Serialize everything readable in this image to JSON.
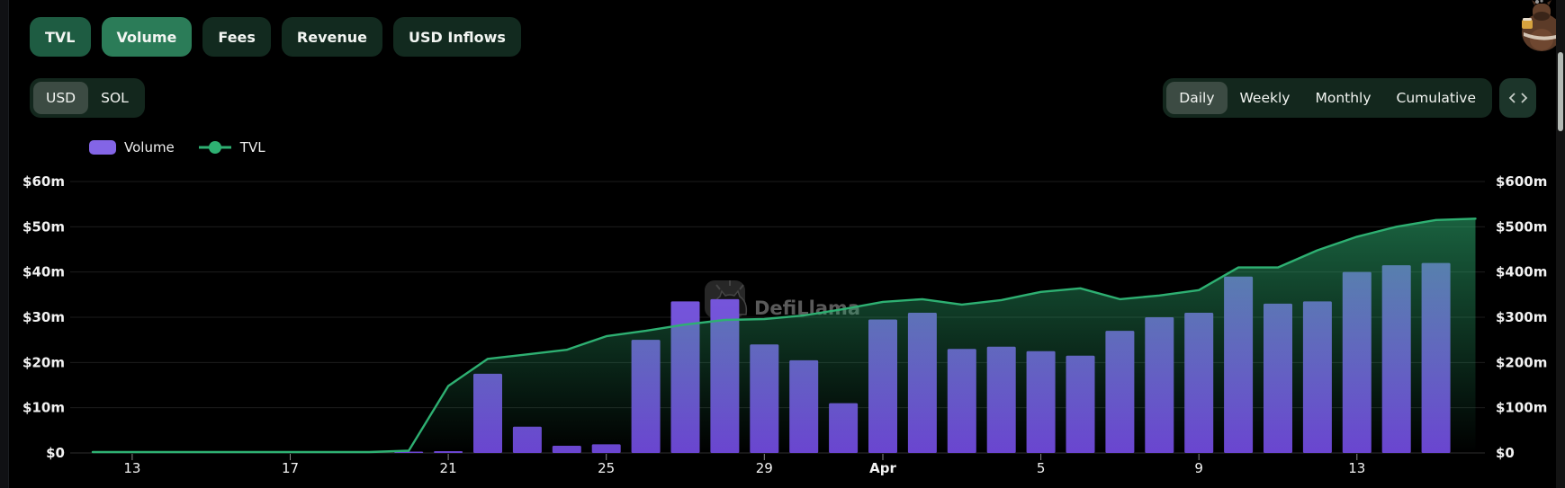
{
  "toolbar": {
    "metric_buttons": [
      {
        "label": "TVL",
        "active": true
      },
      {
        "label": "Volume",
        "active": true
      },
      {
        "label": "Fees",
        "active": false
      },
      {
        "label": "Revenue",
        "active": false
      },
      {
        "label": "USD Inflows",
        "active": false
      }
    ]
  },
  "currency_toggle": {
    "options": [
      "USD",
      "SOL"
    ],
    "selected": "USD"
  },
  "interval_toggle": {
    "options": [
      "Daily",
      "Weekly",
      "Monthly",
      "Cumulative"
    ],
    "selected": "Daily"
  },
  "embed_button": {
    "icon": "code-brackets"
  },
  "legend": [
    {
      "label": "Volume",
      "type": "bar",
      "color": "#8365e6"
    },
    {
      "label": "TVL",
      "type": "line",
      "color": "#2eb072"
    }
  ],
  "watermark": {
    "text": "DefiLlama"
  },
  "chart_data": {
    "type": "bar+line",
    "title": "Volume and TVL (Daily, USD)",
    "dates": [
      "Mar 12",
      "Mar 13",
      "Mar 14",
      "Mar 15",
      "Mar 16",
      "Mar 17",
      "Mar 18",
      "Mar 19",
      "Mar 20",
      "Mar 21",
      "Mar 22",
      "Mar 23",
      "Mar 24",
      "Mar 25",
      "Mar 26",
      "Mar 27",
      "Mar 28",
      "Mar 29",
      "Mar 30",
      "Mar 31",
      "Apr 1",
      "Apr 2",
      "Apr 3",
      "Apr 4",
      "Apr 5",
      "Apr 6",
      "Apr 7",
      "Apr 8",
      "Apr 9",
      "Apr 10",
      "Apr 11",
      "Apr 12",
      "Apr 13",
      "Apr 14",
      "Apr 15",
      "Apr 16"
    ],
    "series": [
      {
        "name": "Volume",
        "type": "bar",
        "axis": "left",
        "unit": "$m",
        "color_top": "#7e62e2",
        "color_bottom": "#6a45d0",
        "values": [
          0,
          0,
          0,
          0,
          0,
          0,
          0,
          0,
          0.3,
          0.4,
          17.5,
          5.8,
          1.6,
          1.9,
          25,
          33.5,
          34,
          24,
          20.5,
          11,
          29.5,
          31,
          23,
          23.5,
          22.5,
          21.5,
          27,
          30,
          31,
          39,
          33,
          33.5,
          40,
          41.5,
          42,
          null
        ]
      },
      {
        "name": "TVL",
        "type": "line",
        "axis": "right",
        "unit": "$m",
        "color": "#2eb072",
        "area_top": "rgba(46,176,114,0.55)",
        "area_bottom": "rgba(46,176,114,0)",
        "values": [
          2,
          2,
          2,
          2,
          2,
          2,
          2,
          2,
          5,
          148,
          208,
          218,
          228,
          258,
          270,
          284,
          294,
          296,
          304,
          318,
          334,
          340,
          328,
          338,
          356,
          364,
          340,
          348,
          360,
          410,
          410,
          448,
          478,
          500,
          515,
          518
        ]
      }
    ],
    "left_axis": {
      "ticks": [
        "$0",
        "$10m",
        "$20m",
        "$30m",
        "$40m",
        "$50m",
        "$60m"
      ],
      "max": 60
    },
    "right_axis": {
      "ticks": [
        "$0",
        "$100m",
        "$200m",
        "$300m",
        "$400m",
        "$500m",
        "$600m"
      ],
      "max": 600
    },
    "x_ticks": [
      {
        "label": "13",
        "index": 1
      },
      {
        "label": "17",
        "index": 5
      },
      {
        "label": "21",
        "index": 9
      },
      {
        "label": "25",
        "index": 13
      },
      {
        "label": "29",
        "index": 17
      },
      {
        "label": "Apr",
        "index": 20,
        "bold": true
      },
      {
        "label": "5",
        "index": 24
      },
      {
        "label": "9",
        "index": 28
      },
      {
        "label": "13",
        "index": 32
      }
    ],
    "grid": true,
    "legend_position": "top-left"
  }
}
